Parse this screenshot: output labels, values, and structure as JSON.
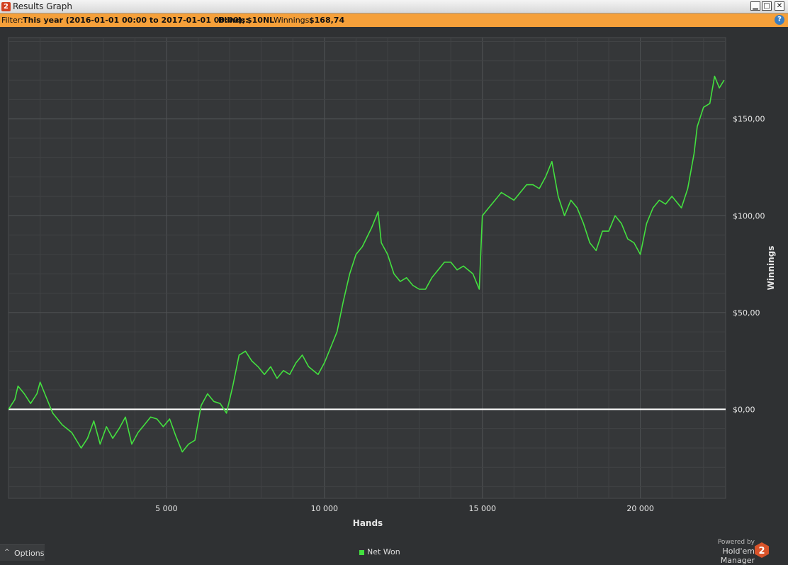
{
  "window": {
    "title": "Results Graph",
    "app_badge": "2",
    "minimize_glyph": "▁",
    "maximize_glyph": "□",
    "close_glyph": "✕"
  },
  "filter": {
    "prefix": "Filter:",
    "range": "This year (2016-01-01 00:00 to 2017-01-01 00:00);",
    "blinds_label": "Blinds:",
    "blinds": "$10NL",
    "winnings_label": "Winnings:",
    "winnings": "$168,74",
    "help_glyph": "?"
  },
  "chart_data": {
    "type": "line",
    "xlabel": "Hands",
    "ylabel": "Winnings",
    "xlim": [
      0,
      22700
    ],
    "ylim": [
      -46,
      192
    ],
    "x_ticks": [
      5000,
      10000,
      15000,
      20000
    ],
    "x_tick_labels": [
      "5 000",
      "10 000",
      "15 000",
      "20 000"
    ],
    "y_ticks": [
      0,
      50,
      100,
      150
    ],
    "y_tick_labels": [
      "$0,00",
      "$50,00",
      "$100,00",
      "$150,00"
    ],
    "grid": true,
    "legend_position": "bottom-center",
    "series": [
      {
        "name": "Net Won",
        "color": "#43e03f",
        "points": [
          [
            0,
            0
          ],
          [
            200,
            5
          ],
          [
            300,
            12
          ],
          [
            500,
            8
          ],
          [
            700,
            3
          ],
          [
            900,
            8
          ],
          [
            1000,
            14
          ],
          [
            1200,
            6
          ],
          [
            1400,
            -2
          ],
          [
            1700,
            -8
          ],
          [
            2000,
            -12
          ],
          [
            2300,
            -20
          ],
          [
            2500,
            -15
          ],
          [
            2700,
            -6
          ],
          [
            2900,
            -18
          ],
          [
            3100,
            -9
          ],
          [
            3300,
            -15
          ],
          [
            3500,
            -10
          ],
          [
            3700,
            -4
          ],
          [
            3900,
            -18
          ],
          [
            4100,
            -12
          ],
          [
            4300,
            -8
          ],
          [
            4500,
            -4
          ],
          [
            4700,
            -5
          ],
          [
            4900,
            -9
          ],
          [
            5100,
            -5
          ],
          [
            5300,
            -14
          ],
          [
            5500,
            -22
          ],
          [
            5700,
            -18
          ],
          [
            5900,
            -16
          ],
          [
            6100,
            2
          ],
          [
            6300,
            8
          ],
          [
            6500,
            4
          ],
          [
            6700,
            3
          ],
          [
            6900,
            -2
          ],
          [
            7100,
            12
          ],
          [
            7300,
            28
          ],
          [
            7500,
            30
          ],
          [
            7700,
            25
          ],
          [
            7900,
            22
          ],
          [
            8100,
            18
          ],
          [
            8300,
            22
          ],
          [
            8500,
            16
          ],
          [
            8700,
            20
          ],
          [
            8900,
            18
          ],
          [
            9100,
            24
          ],
          [
            9300,
            28
          ],
          [
            9500,
            22
          ],
          [
            9800,
            18
          ],
          [
            10000,
            24
          ],
          [
            10200,
            32
          ],
          [
            10400,
            40
          ],
          [
            10600,
            56
          ],
          [
            10800,
            70
          ],
          [
            11000,
            80
          ],
          [
            11200,
            84
          ],
          [
            11500,
            94
          ],
          [
            11700,
            102
          ],
          [
            11800,
            86
          ],
          [
            12000,
            80
          ],
          [
            12200,
            70
          ],
          [
            12400,
            66
          ],
          [
            12600,
            68
          ],
          [
            12800,
            64
          ],
          [
            13000,
            62
          ],
          [
            13200,
            62
          ],
          [
            13400,
            68
          ],
          [
            13600,
            72
          ],
          [
            13800,
            76
          ],
          [
            14000,
            76
          ],
          [
            14200,
            72
          ],
          [
            14400,
            74
          ],
          [
            14700,
            70
          ],
          [
            14900,
            62
          ],
          [
            15000,
            100
          ],
          [
            15200,
            104
          ],
          [
            15400,
            108
          ],
          [
            15600,
            112
          ],
          [
            15800,
            110
          ],
          [
            16000,
            108
          ],
          [
            16200,
            112
          ],
          [
            16400,
            116
          ],
          [
            16600,
            116
          ],
          [
            16800,
            114
          ],
          [
            17000,
            120
          ],
          [
            17200,
            128
          ],
          [
            17400,
            110
          ],
          [
            17600,
            100
          ],
          [
            17800,
            108
          ],
          [
            18000,
            104
          ],
          [
            18200,
            96
          ],
          [
            18400,
            86
          ],
          [
            18600,
            82
          ],
          [
            18800,
            92
          ],
          [
            19000,
            92
          ],
          [
            19200,
            100
          ],
          [
            19400,
            96
          ],
          [
            19600,
            88
          ],
          [
            19800,
            86
          ],
          [
            20000,
            80
          ],
          [
            20200,
            96
          ],
          [
            20400,
            104
          ],
          [
            20600,
            108
          ],
          [
            20800,
            106
          ],
          [
            21000,
            110
          ],
          [
            21300,
            104
          ],
          [
            21500,
            114
          ],
          [
            21700,
            132
          ],
          [
            21800,
            146
          ],
          [
            22000,
            156
          ],
          [
            22200,
            158
          ],
          [
            22350,
            172
          ],
          [
            22500,
            166
          ],
          [
            22650,
            170
          ]
        ]
      }
    ]
  },
  "footer": {
    "options_caret": "^",
    "options_label": "Options",
    "legend_label": "Net Won",
    "powered_by": "Powered by",
    "brand": "Hold'em Manager",
    "brand_badge": "2"
  }
}
